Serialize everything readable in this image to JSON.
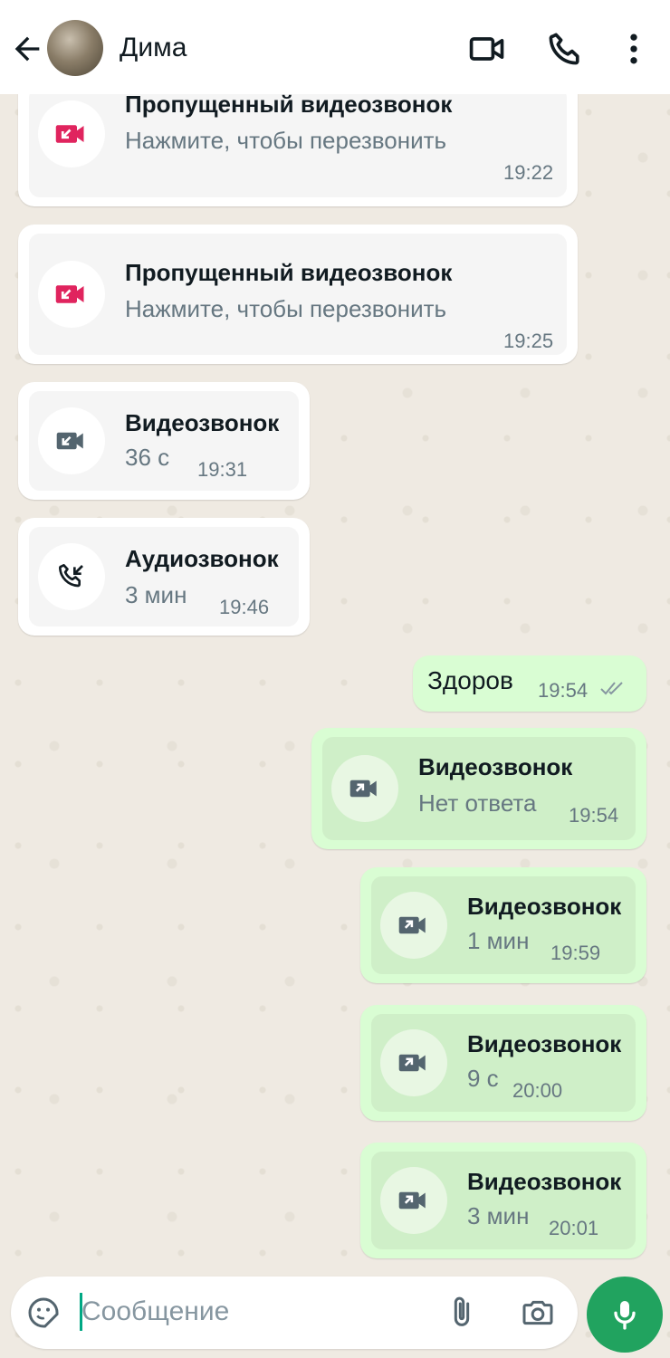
{
  "header": {
    "contact_name": "Дима",
    "icons": [
      "back-arrow-icon",
      "video-call-icon",
      "phone-icon",
      "more-vert-icon"
    ]
  },
  "messages": [
    {
      "type": "call",
      "direction": "in",
      "status": "missed",
      "title": "Пропущенный видеозвонок",
      "subtitle": "Нажмите, чтобы перезвонить",
      "time": "19:22",
      "icon": "missed-video-icon"
    },
    {
      "type": "call",
      "direction": "in",
      "status": "missed",
      "title": "Пропущенный видеозвонок",
      "subtitle": "Нажмите, чтобы перезвонить",
      "time": "19:25",
      "icon": "missed-video-icon"
    },
    {
      "type": "call",
      "direction": "in",
      "title": "Видеозвонок",
      "subtitle": "36 с",
      "time": "19:31",
      "icon": "incoming-video-icon"
    },
    {
      "type": "call",
      "direction": "in",
      "title": "Аудиозвонок",
      "subtitle": "3 мин",
      "time": "19:46",
      "icon": "incoming-audio-icon"
    },
    {
      "type": "text",
      "direction": "out",
      "text": "Здоров",
      "time": "19:54",
      "status": "read"
    },
    {
      "type": "call",
      "direction": "out",
      "title": "Видеозвонок",
      "subtitle": "Нет ответа",
      "time": "19:54",
      "icon": "outgoing-video-icon"
    },
    {
      "type": "call",
      "direction": "out",
      "title": "Видеозвонок",
      "subtitle": "1 мин",
      "time": "19:59",
      "icon": "outgoing-video-icon"
    },
    {
      "type": "call",
      "direction": "out",
      "title": "Видеозвонок",
      "subtitle": "9 с",
      "time": "20:00",
      "icon": "outgoing-video-icon"
    },
    {
      "type": "call",
      "direction": "out",
      "title": "Видеозвонок",
      "subtitle": "3 мин",
      "time": "20:01",
      "icon": "outgoing-video-icon"
    }
  ],
  "input": {
    "placeholder": "Сообщение",
    "icons": [
      "sticker-icon",
      "attach-icon",
      "camera-icon",
      "mic-icon"
    ]
  },
  "colors": {
    "missed_call": "#e0245e",
    "accent": "#21a35f",
    "outgoing_bubble": "#d9fdd3",
    "incoming_bubble": "#ffffff"
  }
}
